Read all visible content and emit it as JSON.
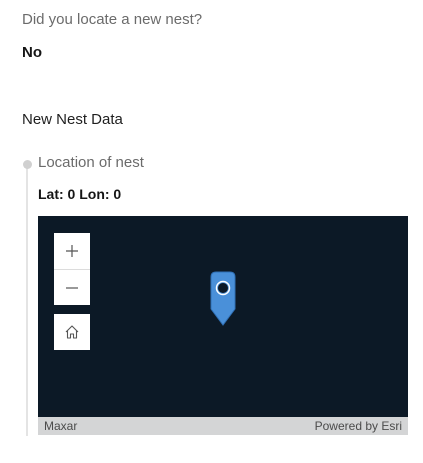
{
  "nest_question": {
    "label": "Did you locate a new nest?",
    "answer": "No"
  },
  "new_nest_group": {
    "title": "New Nest Data"
  },
  "location_field": {
    "label": "Location of nest",
    "coordinates": "Lat: 0 Lon: 0"
  },
  "map": {
    "basemap_color": "#0c1926",
    "pin_color": "#4a90d9",
    "zoom_in_icon": "plus-icon",
    "zoom_out_icon": "minus-icon",
    "home_icon": "home-icon",
    "attribution_left": "Maxar",
    "attribution_right": "Powered by Esri"
  }
}
